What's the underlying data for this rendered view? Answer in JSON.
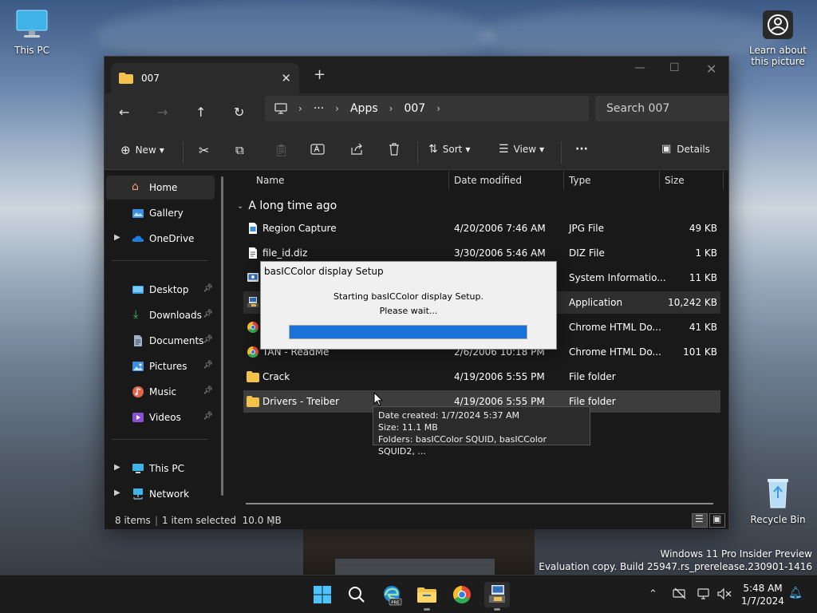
{
  "desktop": {
    "this_pc_label": "This PC",
    "learn_label": "Learn about this picture",
    "recycle_label": "Recycle Bin",
    "watermark_line1": "Windows 11 Pro Insider Preview",
    "watermark_line2": "Evaluation copy. Build 25947.rs_prerelease.230901-1416"
  },
  "window": {
    "tab_title": "007",
    "breadcrumb": [
      "Apps",
      "007"
    ],
    "breadcrumb_more": "···",
    "search_placeholder": "Search 007"
  },
  "toolbar": {
    "new_label": "New",
    "sort_label": "Sort",
    "view_label": "View",
    "more_label": "···",
    "details_label": "Details"
  },
  "nav": {
    "home": "Home",
    "gallery": "Gallery",
    "onedrive": "OneDrive",
    "desktop": "Desktop",
    "downloads": "Downloads",
    "documents": "Documents",
    "pictures": "Pictures",
    "music": "Music",
    "videos": "Videos",
    "thispc": "This PC",
    "network": "Network"
  },
  "columns": {
    "name": "Name",
    "date": "Date modified",
    "type": "Type",
    "size": "Size"
  },
  "group_label": "A long time ago",
  "files": [
    {
      "name": "Region Capture",
      "date": "4/20/2006 7:46 AM",
      "type": "JPG File",
      "size": "49 KB"
    },
    {
      "name": "file_id.diz",
      "date": "3/30/2006 5:46 AM",
      "type": "DIZ File",
      "size": "1 KB"
    },
    {
      "name": "",
      "date": "",
      "type": "System Informatio...",
      "size": "11 KB"
    },
    {
      "name": "",
      "date": "",
      "type": "Application",
      "size": "10,242 KB"
    },
    {
      "name": "",
      "date": "",
      "type": "Chrome HTML Do...",
      "size": "41 KB"
    },
    {
      "name": "TAN - ReadMe",
      "date": "2/6/2006 10:18 PM",
      "type": "Chrome HTML Do...",
      "size": "101 KB"
    },
    {
      "name": "Crack",
      "date": "4/19/2006 5:55 PM",
      "type": "File folder",
      "size": ""
    },
    {
      "name": "Drivers - Treiber",
      "date": "4/19/2006 5:55 PM",
      "type": "File folder",
      "size": ""
    }
  ],
  "status": {
    "count": "8 items",
    "selected": "1 item selected  10.0 MB"
  },
  "dialog": {
    "title": "basICColor display Setup",
    "message1": "Starting basICColor display Setup.",
    "message2": "Please wait...",
    "progress": 1.0
  },
  "tooltip": {
    "line1": "Date created: 1/7/2024 5:37 AM",
    "line2": "Size: 11.1 MB",
    "line3": "Folders: basICColor SQUID, basICColor SQUID2, ..."
  },
  "taskbar": {
    "time": "5:48 AM",
    "date": "1/7/2024"
  },
  "colors": {
    "accent": "#1a73d9",
    "folder": "#f3c24a",
    "window_bg": "#191919"
  }
}
